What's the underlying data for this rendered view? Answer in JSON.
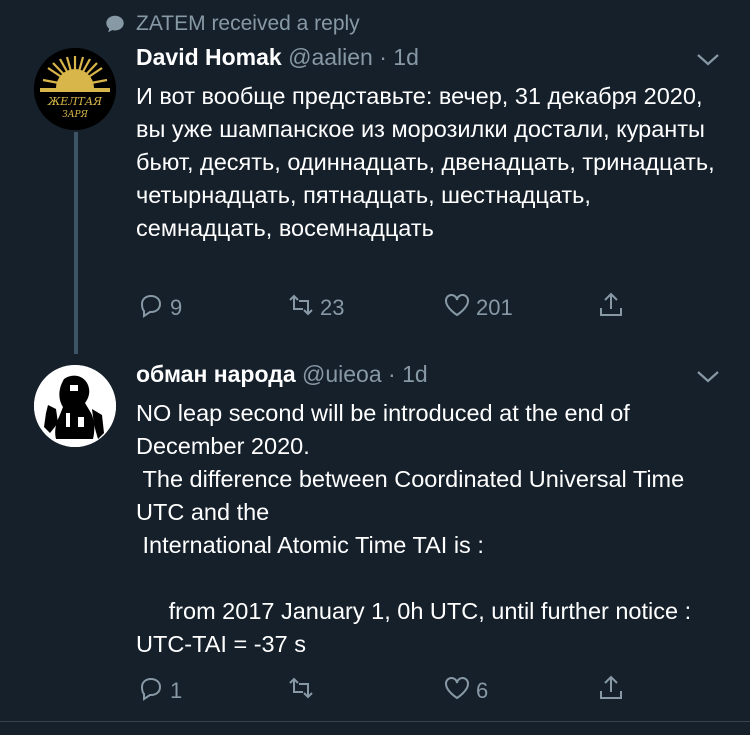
{
  "context": {
    "icon": "speech-bubble-icon",
    "text": "ZATEM received a reply"
  },
  "tweets": [
    {
      "avatar": {
        "label_line1": "ЖЕЛТАЯ",
        "label_line2": "ЗАРЯ"
      },
      "name": "David Homak",
      "handle": "@aalien",
      "separator": "·",
      "time": "1d",
      "text": "И вот вообще представьте: вечер, 31 декабря 2020, вы уже шампанское из морозилки достали, куранты бьют, десять, одиннадцать, двенадцать, тринадцать, четырнадцать, пятнадцать, шестнадцать, семнадцать, восемнадцать",
      "actions": {
        "replies": "9",
        "retweets": "23",
        "likes": "201"
      }
    },
    {
      "name": "обман народа",
      "handle": "@uieoa",
      "separator": "·",
      "time": "1d",
      "text": "NO leap second will be introduced at the end of December 2020.\n The difference between Coordinated Universal Time UTC and the\n International Atomic Time TAI is :\n\n     from 2017 January 1, 0h UTC, until further notice : UTC-TAI = -37 s",
      "actions": {
        "replies": "1",
        "retweets": "",
        "likes": "6"
      }
    }
  ],
  "colors": {
    "background": "#15202b",
    "secondary_text": "#8899a6",
    "thread_line": "#3d5466",
    "avatar_gold": "#d9b64a"
  }
}
